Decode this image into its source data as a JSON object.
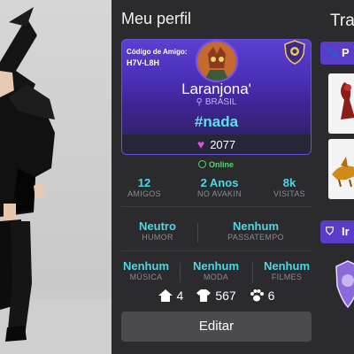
{
  "profile": {
    "title": "Meu perfil",
    "friend_code_label": "Código de Amigo:",
    "friend_code": "H7V-L8H",
    "username": "Laranjona'",
    "location": "BRASIL",
    "hashtag": "#nada",
    "hearts": "2077",
    "status": "Online",
    "stats_top": [
      {
        "value": "12",
        "label": "AMIGOS"
      },
      {
        "value": "2 Anos",
        "label": "NO AVAKIN"
      },
      {
        "value": "8k",
        "label": "VISITAS"
      }
    ],
    "stats_mid": [
      {
        "value": "Neutro",
        "label": "HUMOR"
      },
      {
        "value": "Nenhum",
        "label": "PASSATEMPO"
      }
    ],
    "stats_bottom": [
      {
        "value": "Nenhum",
        "label": "MÚSICA"
      },
      {
        "value": "Nenhum",
        "label": "MODA"
      },
      {
        "value": "Nenhum",
        "label": "FILMES"
      }
    ],
    "counts": [
      {
        "icon": "house-icon",
        "value": "4"
      },
      {
        "icon": "shirt-icon",
        "value": "567"
      },
      {
        "icon": "paw-icon",
        "value": "6"
      }
    ],
    "edit_label": "Editar"
  },
  "right_panel": {
    "title": "Tra",
    "tab1_label": "P",
    "tab2_label": "Ir"
  },
  "colors": {
    "accent_cyan": "#4fd6e3",
    "card_purple": "#5b3fd0",
    "online_green": "#55d66a",
    "heart_pink": "#e04ed8"
  }
}
